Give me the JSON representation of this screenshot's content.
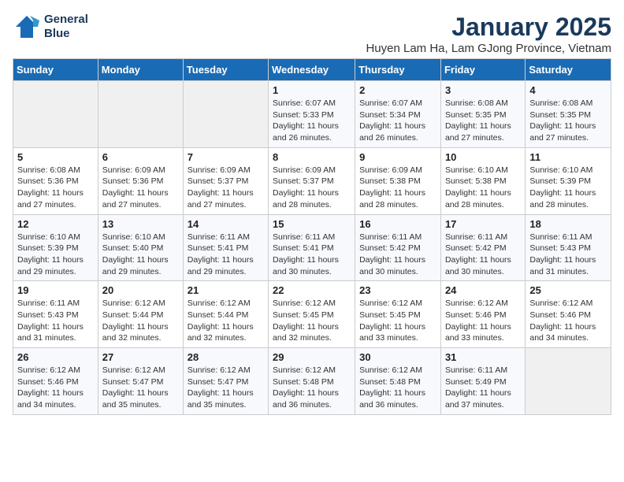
{
  "header": {
    "logo_line1": "General",
    "logo_line2": "Blue",
    "title": "January 2025",
    "subtitle": "Huyen Lam Ha, Lam GJong Province, Vietnam"
  },
  "days_of_week": [
    "Sunday",
    "Monday",
    "Tuesday",
    "Wednesday",
    "Thursday",
    "Friday",
    "Saturday"
  ],
  "weeks": [
    [
      {
        "num": "",
        "detail": ""
      },
      {
        "num": "",
        "detail": ""
      },
      {
        "num": "",
        "detail": ""
      },
      {
        "num": "1",
        "detail": "Sunrise: 6:07 AM\nSunset: 5:33 PM\nDaylight: 11 hours and 26 minutes."
      },
      {
        "num": "2",
        "detail": "Sunrise: 6:07 AM\nSunset: 5:34 PM\nDaylight: 11 hours and 26 minutes."
      },
      {
        "num": "3",
        "detail": "Sunrise: 6:08 AM\nSunset: 5:35 PM\nDaylight: 11 hours and 27 minutes."
      },
      {
        "num": "4",
        "detail": "Sunrise: 6:08 AM\nSunset: 5:35 PM\nDaylight: 11 hours and 27 minutes."
      }
    ],
    [
      {
        "num": "5",
        "detail": "Sunrise: 6:08 AM\nSunset: 5:36 PM\nDaylight: 11 hours and 27 minutes."
      },
      {
        "num": "6",
        "detail": "Sunrise: 6:09 AM\nSunset: 5:36 PM\nDaylight: 11 hours and 27 minutes."
      },
      {
        "num": "7",
        "detail": "Sunrise: 6:09 AM\nSunset: 5:37 PM\nDaylight: 11 hours and 27 minutes."
      },
      {
        "num": "8",
        "detail": "Sunrise: 6:09 AM\nSunset: 5:37 PM\nDaylight: 11 hours and 28 minutes."
      },
      {
        "num": "9",
        "detail": "Sunrise: 6:09 AM\nSunset: 5:38 PM\nDaylight: 11 hours and 28 minutes."
      },
      {
        "num": "10",
        "detail": "Sunrise: 6:10 AM\nSunset: 5:38 PM\nDaylight: 11 hours and 28 minutes."
      },
      {
        "num": "11",
        "detail": "Sunrise: 6:10 AM\nSunset: 5:39 PM\nDaylight: 11 hours and 28 minutes."
      }
    ],
    [
      {
        "num": "12",
        "detail": "Sunrise: 6:10 AM\nSunset: 5:39 PM\nDaylight: 11 hours and 29 minutes."
      },
      {
        "num": "13",
        "detail": "Sunrise: 6:10 AM\nSunset: 5:40 PM\nDaylight: 11 hours and 29 minutes."
      },
      {
        "num": "14",
        "detail": "Sunrise: 6:11 AM\nSunset: 5:41 PM\nDaylight: 11 hours and 29 minutes."
      },
      {
        "num": "15",
        "detail": "Sunrise: 6:11 AM\nSunset: 5:41 PM\nDaylight: 11 hours and 30 minutes."
      },
      {
        "num": "16",
        "detail": "Sunrise: 6:11 AM\nSunset: 5:42 PM\nDaylight: 11 hours and 30 minutes."
      },
      {
        "num": "17",
        "detail": "Sunrise: 6:11 AM\nSunset: 5:42 PM\nDaylight: 11 hours and 30 minutes."
      },
      {
        "num": "18",
        "detail": "Sunrise: 6:11 AM\nSunset: 5:43 PM\nDaylight: 11 hours and 31 minutes."
      }
    ],
    [
      {
        "num": "19",
        "detail": "Sunrise: 6:11 AM\nSunset: 5:43 PM\nDaylight: 11 hours and 31 minutes."
      },
      {
        "num": "20",
        "detail": "Sunrise: 6:12 AM\nSunset: 5:44 PM\nDaylight: 11 hours and 32 minutes."
      },
      {
        "num": "21",
        "detail": "Sunrise: 6:12 AM\nSunset: 5:44 PM\nDaylight: 11 hours and 32 minutes."
      },
      {
        "num": "22",
        "detail": "Sunrise: 6:12 AM\nSunset: 5:45 PM\nDaylight: 11 hours and 32 minutes."
      },
      {
        "num": "23",
        "detail": "Sunrise: 6:12 AM\nSunset: 5:45 PM\nDaylight: 11 hours and 33 minutes."
      },
      {
        "num": "24",
        "detail": "Sunrise: 6:12 AM\nSunset: 5:46 PM\nDaylight: 11 hours and 33 minutes."
      },
      {
        "num": "25",
        "detail": "Sunrise: 6:12 AM\nSunset: 5:46 PM\nDaylight: 11 hours and 34 minutes."
      }
    ],
    [
      {
        "num": "26",
        "detail": "Sunrise: 6:12 AM\nSunset: 5:46 PM\nDaylight: 11 hours and 34 minutes."
      },
      {
        "num": "27",
        "detail": "Sunrise: 6:12 AM\nSunset: 5:47 PM\nDaylight: 11 hours and 35 minutes."
      },
      {
        "num": "28",
        "detail": "Sunrise: 6:12 AM\nSunset: 5:47 PM\nDaylight: 11 hours and 35 minutes."
      },
      {
        "num": "29",
        "detail": "Sunrise: 6:12 AM\nSunset: 5:48 PM\nDaylight: 11 hours and 36 minutes."
      },
      {
        "num": "30",
        "detail": "Sunrise: 6:12 AM\nSunset: 5:48 PM\nDaylight: 11 hours and 36 minutes."
      },
      {
        "num": "31",
        "detail": "Sunrise: 6:11 AM\nSunset: 5:49 PM\nDaylight: 11 hours and 37 minutes."
      },
      {
        "num": "",
        "detail": ""
      }
    ]
  ],
  "colors": {
    "header_bg": "#1a6bb5",
    "title_color": "#1a3a5c"
  }
}
